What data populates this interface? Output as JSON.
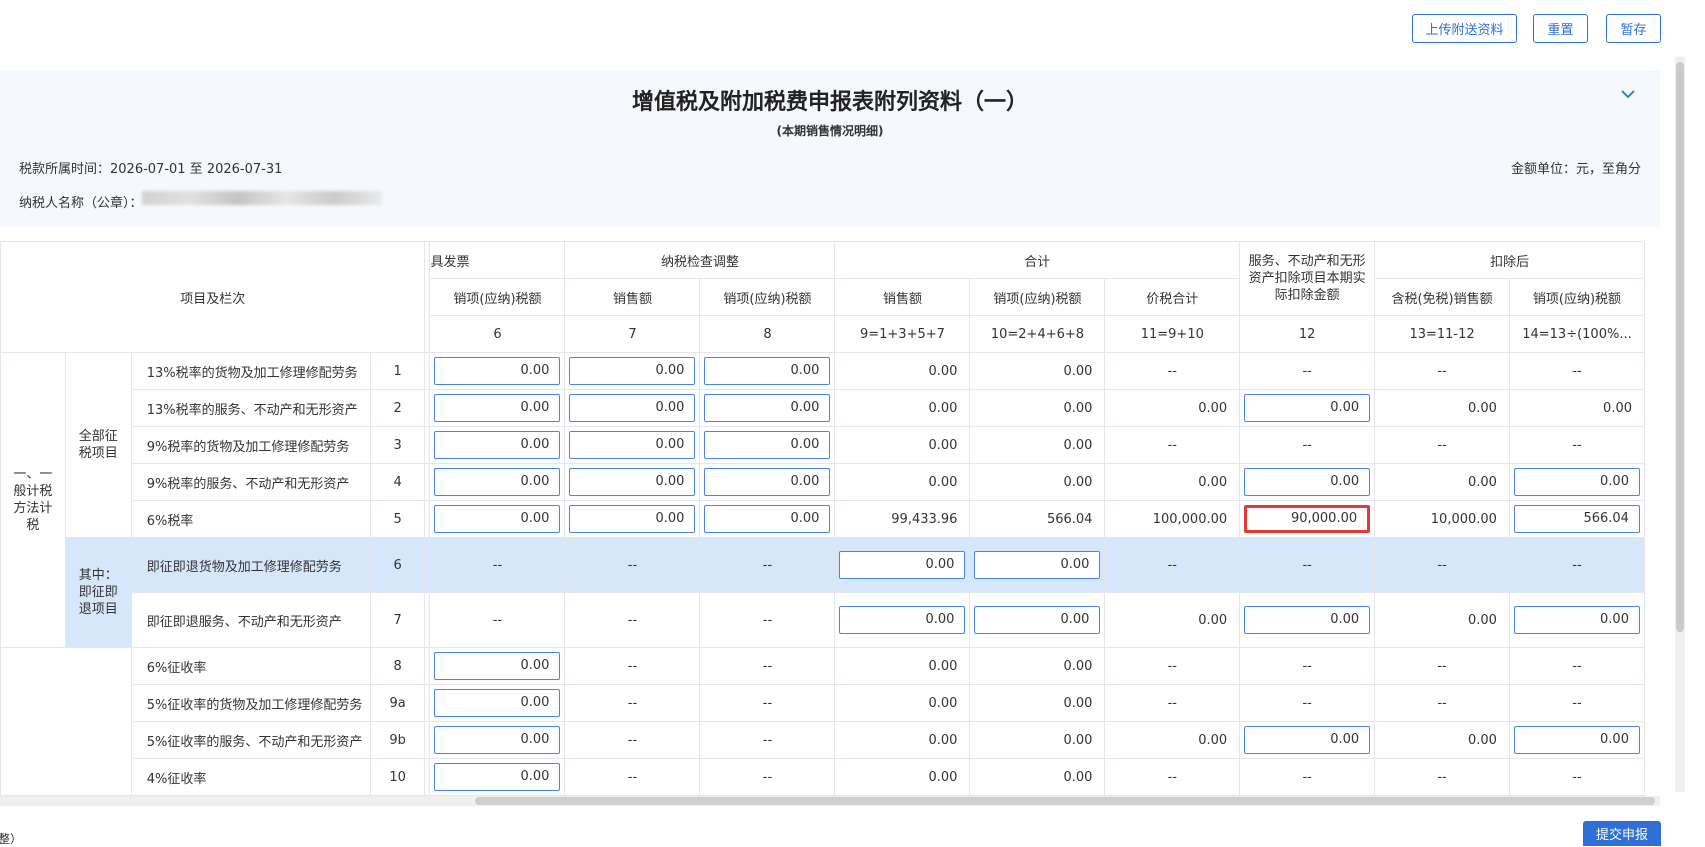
{
  "toolbar": {
    "upload_label": "上传附送资料",
    "reset_label": "重置",
    "save_label": "暂存"
  },
  "header": {
    "title": "增值税及附加税费申报表附列资料（一）",
    "subtitle": "(本期销售情况明细)",
    "period": "税款所属时间：2026-07-01 至 2026-07-31",
    "unit": "金额单位：元，至角分",
    "taxpayer_label": "纳税人名称（公章）：",
    "collapse_icon": "chevron-down-icon"
  },
  "table": {
    "project_header": "项目及栏次",
    "group_headers": [
      "具发票",
      "纳税检查调整",
      "合计",
      "服务、不动产和无形资产扣除项目本期实际扣除金额",
      "扣除后"
    ],
    "sub_headers": [
      "销项(应纳)税额",
      "销售额",
      "销项(应纳)税额",
      "销售额",
      "销项(应纳)税额",
      "价税合计",
      "含税(免税)销售额",
      "销项(应纳)税额"
    ],
    "col_numbers": [
      "6",
      "7",
      "8",
      "9=1+3+5+7",
      "10=2+4+6+8",
      "11=9+10",
      "12",
      "13=11-12",
      "14=13÷(100%..."
    ],
    "section_general": "一、一般计税方法计税",
    "group_full": "全部征税项目",
    "group_refund": "其中：即征即退项目",
    "rows": [
      {
        "label": "13%税率的货物及加工修理修配劳务",
        "no": "1",
        "c6": "0.00",
        "c7": "0.00",
        "c8": "0.00",
        "c9": "0.00",
        "c10": "0.00",
        "c11": "--",
        "c12": "--",
        "c13": "--",
        "c14": "--"
      },
      {
        "label": "13%税率的服务、不动产和无形资产",
        "no": "2",
        "c6": "0.00",
        "c7": "0.00",
        "c8": "0.00",
        "c9": "0.00",
        "c10": "0.00",
        "c11": "0.00",
        "c12": "0.00",
        "c13": "0.00",
        "c14": "0.00"
      },
      {
        "label": "9%税率的货物及加工修理修配劳务",
        "no": "3",
        "c6": "0.00",
        "c7": "0.00",
        "c8": "0.00",
        "c9": "0.00",
        "c10": "0.00",
        "c11": "--",
        "c12": "--",
        "c13": "--",
        "c14": "--"
      },
      {
        "label": "9%税率的服务、不动产和无形资产",
        "no": "4",
        "c6": "0.00",
        "c7": "0.00",
        "c8": "0.00",
        "c9": "0.00",
        "c10": "0.00",
        "c11": "0.00",
        "c12": "0.00",
        "c13": "0.00",
        "c14": "0.00"
      },
      {
        "label": "6%税率",
        "no": "5",
        "c6": "0.00",
        "c7": "0.00",
        "c8": "0.00",
        "c9": "99,433.96",
        "c10": "566.04",
        "c11": "100,000.00",
        "c12": "90,000.00",
        "c13": "10,000.00",
        "c14": "566.04"
      },
      {
        "label": "即征即退货物及加工修理修配劳务",
        "no": "6",
        "c6": "--",
        "c7": "--",
        "c8": "--",
        "c9": "0.00",
        "c10": "0.00",
        "c11": "--",
        "c12": "--",
        "c13": "--",
        "c14": "--"
      },
      {
        "label": "即征即退服务、不动产和无形资产",
        "no": "7",
        "c6": "--",
        "c7": "--",
        "c8": "--",
        "c9": "0.00",
        "c10": "0.00",
        "c11": "0.00",
        "c12": "0.00",
        "c13": "0.00",
        "c14": "0.00"
      },
      {
        "label": "6%征收率",
        "no": "8",
        "c6": "0.00",
        "c7": "--",
        "c8": "--",
        "c9": "0.00",
        "c10": "0.00",
        "c11": "--",
        "c12": "--",
        "c13": "--",
        "c14": "--"
      },
      {
        "label": "5%征收率的货物及加工修理修配劳务",
        "no": "9a",
        "c6": "0.00",
        "c7": "--",
        "c8": "--",
        "c9": "0.00",
        "c10": "0.00",
        "c11": "--",
        "c12": "--",
        "c13": "--",
        "c14": "--"
      },
      {
        "label": "5%征收率的服务、不动产和无形资产",
        "no": "9b",
        "c6": "0.00",
        "c7": "--",
        "c8": "--",
        "c9": "0.00",
        "c10": "0.00",
        "c11": "0.00",
        "c12": "0.00",
        "c13": "0.00",
        "c14": "0.00"
      },
      {
        "label": "4%征收率",
        "no": "10",
        "c6": "0.00",
        "c7": "--",
        "c8": "--",
        "c9": "0.00",
        "c10": "0.00",
        "c11": "--",
        "c12": "--",
        "c13": "--",
        "c14": "--"
      }
    ]
  },
  "footer": {
    "left_text": "整）",
    "submit_label": "提交申报"
  },
  "colors": {
    "accent": "#2f6fd6",
    "highlight_row": "#d6e7fb",
    "error_border": "#e53935"
  }
}
